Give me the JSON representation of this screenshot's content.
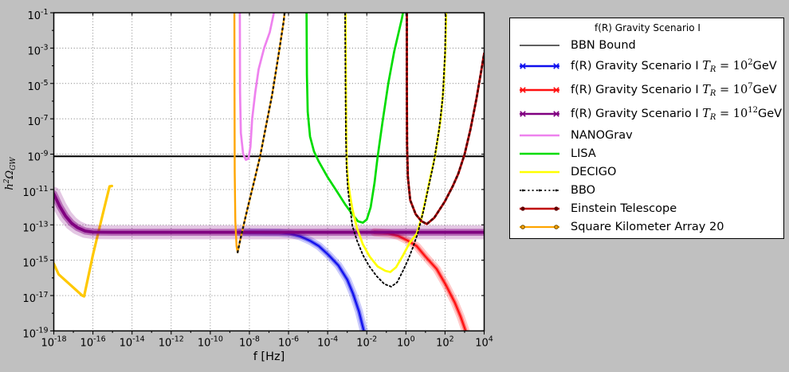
{
  "figure": {
    "bg": "#c0c0c0",
    "plot_bg": "#ffffff",
    "frame_color": "#000000",
    "grid_color": "#7a7a7a"
  },
  "axes": {
    "xlabel": "f [Hz]",
    "ylabel_parts": {
      "h": "h",
      "h_exp": "2",
      "omega": "Ω",
      "sub": "GW"
    },
    "tick_base": "10",
    "x_major_exps": [
      -18,
      -16,
      -14,
      -12,
      -10,
      -8,
      -6,
      -4,
      -2,
      0,
      2,
      4
    ],
    "x_minor_exps": [
      -17,
      -15,
      -13,
      -11,
      -9,
      -7,
      -5,
      -3,
      -1,
      1,
      3
    ],
    "y_major_exps": [
      -1,
      -3,
      -5,
      -7,
      -9,
      -11,
      -13,
      -15,
      -17,
      -19
    ],
    "y_minor_exps": [
      -2,
      -4,
      -6,
      -8,
      -10,
      -12,
      -14,
      -16,
      -18
    ],
    "x_log_range": [
      -18,
      4
    ],
    "y_log_range": [
      -19,
      -1
    ]
  },
  "legend": {
    "title": "f(R) Gravity Scenario I",
    "entries": [
      {
        "label": "BBN Bound",
        "color": "#000000",
        "lw": 1.3,
        "style": "line"
      },
      {
        "pre": "f(R) Gravity Scenario I ",
        "T": "T",
        "Tsub": "R",
        "eq": " = 10",
        "exp": "2",
        "unit": "GeV",
        "color": "#0f0fee",
        "lw": 2.4,
        "style": "xline"
      },
      {
        "pre": "f(R) Gravity Scenario I ",
        "T": "T",
        "Tsub": "R",
        "eq": " = 10",
        "exp": "7",
        "unit": "GeV",
        "color": "#ff0f0f",
        "lw": 2.4,
        "style": "xline"
      },
      {
        "pre": "f(R) Gravity Scenario I ",
        "T": "T",
        "Tsub": "R",
        "eq": " = 10",
        "exp": "12",
        "unit": "GeV",
        "color": "#800080",
        "lw": 2.4,
        "style": "xline"
      },
      {
        "label": "NANOGrav",
        "color": "#ee82ee",
        "lw": 2.6,
        "style": "line"
      },
      {
        "label": "LISA",
        "color": "#00dc00",
        "lw": 2.6,
        "style": "line"
      },
      {
        "label": "DECIGO",
        "color": "#ffff00",
        "lw": 2.6,
        "style": "line"
      },
      {
        "label": "BBO",
        "color": "#000000",
        "lw": 1.8,
        "style": "dotted"
      },
      {
        "label": "Einstein Telescope",
        "color": "#c00000",
        "lw": 2.6,
        "style": "dotline"
      },
      {
        "label": "Square Kilometer Array 20",
        "color": "#ffa500",
        "lw": 2.2,
        "style": "circline"
      }
    ]
  },
  "chart_data": {
    "type": "line",
    "title": "",
    "xlabel": "f [Hz]",
    "ylabel": "h^2 Omega_GW",
    "xscale": "log",
    "yscale": "log",
    "xlim_exp": [
      -18,
      4
    ],
    "ylim_exp": [
      -19,
      -1
    ],
    "grid": true,
    "legend_position": "outside-right",
    "note": "points are [log10(f/Hz), log10(h2OmegaGW)]",
    "series": [
      {
        "name": "BBN Bound",
        "color": "#000000",
        "lw": 2.0,
        "style": "solid",
        "halo": false,
        "points": [
          [
            -18,
            -9.12
          ],
          [
            4,
            -9.12
          ]
        ]
      },
      {
        "name": "gold curve (unlabeled, low-f)",
        "color": "#ffc800",
        "lw": 3.2,
        "style": "solid",
        "halo": false,
        "points": [
          [
            -18,
            -15.2
          ],
          [
            -17.75,
            -15.8
          ],
          [
            -17.2,
            -16.35
          ],
          [
            -16.55,
            -17.0
          ],
          [
            -16.45,
            -17.05
          ],
          [
            -16.0,
            -14.7
          ],
          [
            -15.5,
            -12.4
          ],
          [
            -15.15,
            -10.82
          ],
          [
            -15.03,
            -10.8
          ]
        ]
      },
      {
        "name": "f(R) Scenario I TR=10^2 GeV",
        "color": "#0f0fee",
        "lw": 2.2,
        "style": "solid",
        "halo": true,
        "points": [
          [
            -8.5,
            -13.42
          ],
          [
            -6.5,
            -13.44
          ],
          [
            -5.9,
            -13.5
          ],
          [
            -5.4,
            -13.65
          ],
          [
            -4.9,
            -13.9
          ],
          [
            -4.45,
            -14.2
          ],
          [
            -3.96,
            -14.7
          ],
          [
            -3.45,
            -15.3
          ],
          [
            -3.0,
            -16.1
          ],
          [
            -2.7,
            -16.9
          ],
          [
            -2.4,
            -17.9
          ],
          [
            -2.15,
            -19.0
          ],
          [
            -2.1,
            -19.5
          ]
        ]
      },
      {
        "name": "f(R) Scenario I TR=10^7 GeV",
        "color": "#ff0f0f",
        "lw": 2.2,
        "style": "solid",
        "halo": true,
        "points": [
          [
            -1.6,
            -13.42
          ],
          [
            -0.9,
            -13.48
          ],
          [
            -0.4,
            -13.62
          ],
          [
            0.1,
            -13.9
          ],
          [
            0.55,
            -14.2
          ],
          [
            1.0,
            -14.8
          ],
          [
            1.57,
            -15.5
          ],
          [
            2.04,
            -16.4
          ],
          [
            2.5,
            -17.4
          ],
          [
            2.8,
            -18.2
          ],
          [
            3.05,
            -19.0
          ],
          [
            3.1,
            -19.5
          ]
        ]
      },
      {
        "name": "f(R) Scenario I TR=10^12 GeV",
        "color": "#800080",
        "lw": 3.8,
        "style": "solid",
        "halo": true,
        "points": [
          [
            -18,
            -11.25
          ],
          [
            -17.7,
            -11.95
          ],
          [
            -17.4,
            -12.5
          ],
          [
            -17.1,
            -12.9
          ],
          [
            -16.8,
            -13.15
          ],
          [
            -16.4,
            -13.35
          ],
          [
            -16.0,
            -13.41
          ],
          [
            -15.0,
            -13.42
          ],
          [
            4,
            -13.42
          ]
        ]
      },
      {
        "name": "NANOGrav",
        "color": "#ee82ee",
        "lw": 2.7,
        "style": "solid",
        "halo": false,
        "points": [
          [
            -8.49,
            -0.8
          ],
          [
            -8.48,
            -5.5
          ],
          [
            -8.44,
            -7.8
          ],
          [
            -8.32,
            -9.0
          ],
          [
            -8.18,
            -9.32
          ],
          [
            -8.05,
            -9.25
          ],
          [
            -7.95,
            -8.6
          ],
          [
            -7.86,
            -7.0
          ],
          [
            -7.7,
            -5.5
          ],
          [
            -7.53,
            -4.2
          ],
          [
            -7.25,
            -3.0
          ],
          [
            -6.96,
            -2.1
          ],
          [
            -6.71,
            -0.8
          ]
        ]
      },
      {
        "name": "LISA",
        "color": "#00dc00",
        "lw": 2.7,
        "style": "solid",
        "halo": false,
        "points": [
          [
            -5.08,
            -0.8
          ],
          [
            -5.06,
            -4.5
          ],
          [
            -5.02,
            -6.6
          ],
          [
            -4.9,
            -8.0
          ],
          [
            -4.7,
            -8.85
          ],
          [
            -4.46,
            -9.4
          ],
          [
            -4.0,
            -10.3
          ],
          [
            -3.56,
            -11.05
          ],
          [
            -3.1,
            -11.85
          ],
          [
            -2.74,
            -12.4
          ],
          [
            -2.45,
            -12.8
          ],
          [
            -2.2,
            -12.88
          ],
          [
            -2.0,
            -12.7
          ],
          [
            -1.8,
            -12.0
          ],
          [
            -1.6,
            -10.6
          ],
          [
            -1.45,
            -9.2
          ],
          [
            -1.2,
            -7.2
          ],
          [
            -0.9,
            -5.0
          ],
          [
            -0.6,
            -3.2
          ],
          [
            -0.2,
            -1.3
          ],
          [
            -0.12,
            -0.8
          ]
        ]
      },
      {
        "name": "DECIGO",
        "color": "#ffff00",
        "lw": 2.7,
        "style": "solid",
        "halo": false,
        "points": [
          [
            -3.09,
            -0.8
          ],
          [
            -3.07,
            -5.0
          ],
          [
            -3.05,
            -8.0
          ],
          [
            -3.02,
            -9.6
          ],
          [
            -2.95,
            -10.6
          ],
          [
            -2.85,
            -11.4
          ],
          [
            -2.72,
            -12.2
          ],
          [
            -2.5,
            -13.2
          ],
          [
            -2.2,
            -14.1
          ],
          [
            -1.85,
            -14.8
          ],
          [
            -1.45,
            -15.35
          ],
          [
            -1.05,
            -15.6
          ],
          [
            -0.8,
            -15.67
          ],
          [
            -0.5,
            -15.4
          ],
          [
            -0.16,
            -14.75
          ],
          [
            0.2,
            -14.0
          ],
          [
            0.55,
            -13.5
          ],
          [
            0.8,
            -12.6
          ],
          [
            1.0,
            -11.6
          ],
          [
            1.25,
            -10.3
          ],
          [
            1.49,
            -9.1
          ],
          [
            1.78,
            -7.0
          ],
          [
            1.92,
            -5.3
          ],
          [
            2.02,
            -3.0
          ],
          [
            2.06,
            -0.8
          ]
        ]
      },
      {
        "name": "BBO",
        "color": "#000000",
        "lw": 1.9,
        "style": "dotted",
        "halo": false,
        "points": [
          [
            -3.11,
            -0.8
          ],
          [
            -3.09,
            -5.0
          ],
          [
            -3.07,
            -8.0
          ],
          [
            -3.03,
            -9.8
          ],
          [
            -2.97,
            -10.9
          ],
          [
            -2.88,
            -11.8
          ],
          [
            -2.74,
            -13.05
          ],
          [
            -2.5,
            -13.9
          ],
          [
            -2.2,
            -14.7
          ],
          [
            -1.9,
            -15.3
          ],
          [
            -1.5,
            -15.9
          ],
          [
            -1.1,
            -16.35
          ],
          [
            -0.75,
            -16.5
          ],
          [
            -0.45,
            -16.25
          ],
          [
            -0.15,
            -15.6
          ],
          [
            0.1,
            -15.0
          ],
          [
            0.35,
            -14.3
          ],
          [
            0.6,
            -13.5
          ],
          [
            0.9,
            -12.2
          ],
          [
            1.15,
            -10.9
          ],
          [
            1.42,
            -9.5
          ],
          [
            1.7,
            -7.6
          ],
          [
            1.88,
            -5.8
          ],
          [
            2.0,
            -3.3
          ],
          [
            2.04,
            -0.8
          ]
        ]
      },
      {
        "name": "Einstein Telescope",
        "color": "#c00000",
        "lw": 2.8,
        "style": "solid",
        "halo": false,
        "dots_from": 0,
        "dot_color": "#500000",
        "points": [
          [
            0.05,
            -0.8
          ],
          [
            0.05,
            -5.0
          ],
          [
            0.06,
            -8.5
          ],
          [
            0.1,
            -10.3
          ],
          [
            0.22,
            -11.6
          ],
          [
            0.5,
            -12.4
          ],
          [
            0.8,
            -12.8
          ],
          [
            1.07,
            -12.95
          ],
          [
            1.45,
            -12.6
          ],
          [
            1.98,
            -11.7
          ],
          [
            2.4,
            -10.8
          ],
          [
            2.68,
            -10.1
          ],
          [
            3.0,
            -9.0
          ],
          [
            3.3,
            -7.6
          ],
          [
            3.6,
            -5.9
          ],
          [
            3.85,
            -4.3
          ],
          [
            4.0,
            -3.3
          ]
        ]
      },
      {
        "name": "Square Kilometer Array 20",
        "color": "#ffa500",
        "lw": 2.4,
        "style": "solid",
        "halo": false,
        "dots_from": 5,
        "dot_color": "#1a1a1a",
        "points": [
          [
            -8.77,
            -0.8
          ],
          [
            -8.76,
            -6.0
          ],
          [
            -8.75,
            -10.0
          ],
          [
            -8.72,
            -12.8
          ],
          [
            -8.66,
            -14.2
          ],
          [
            -8.6,
            -14.55
          ],
          [
            -8.5,
            -14.0
          ],
          [
            -8.25,
            -12.8
          ],
          [
            -8.06,
            -11.9
          ],
          [
            -7.75,
            -10.5
          ],
          [
            -7.45,
            -9.1
          ],
          [
            -7.15,
            -7.4
          ],
          [
            -6.84,
            -5.66
          ],
          [
            -6.5,
            -3.3
          ],
          [
            -6.25,
            -1.5
          ],
          [
            -6.18,
            -0.8
          ]
        ]
      }
    ]
  }
}
